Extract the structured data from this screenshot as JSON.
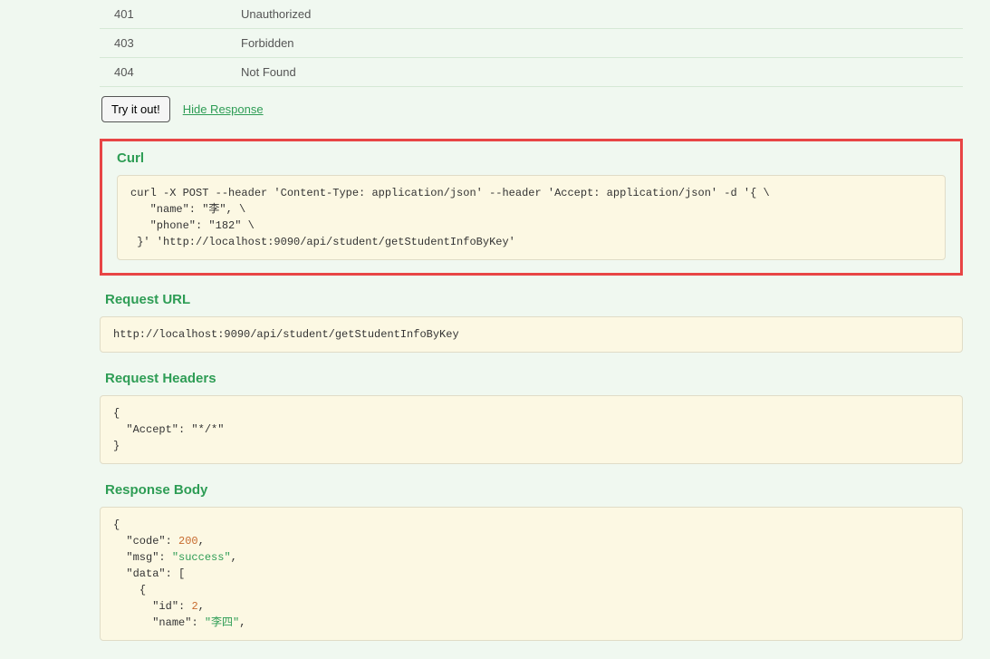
{
  "status_codes": [
    {
      "code": "401",
      "text": "Unauthorized"
    },
    {
      "code": "403",
      "text": "Forbidden"
    },
    {
      "code": "404",
      "text": "Not Found"
    }
  ],
  "actions": {
    "try_label": "Try it out!",
    "hide_label": "Hide Response"
  },
  "sections": {
    "curl": {
      "title": "Curl",
      "content": "curl -X POST --header 'Content-Type: application/json' --header 'Accept: application/json' -d '{ \\ \n   \"name\": \"李\", \\ \n   \"phone\": \"182\" \\ \n }' 'http://localhost:9090/api/student/getStudentInfoByKey'"
    },
    "request_url": {
      "title": "Request URL",
      "content": "http://localhost:9090/api/student/getStudentInfoByKey"
    },
    "request_headers": {
      "title": "Request Headers",
      "content": "{\n  \"Accept\": \"*/*\"\n}"
    },
    "response_body": {
      "title": "Response Body",
      "tokens": [
        {
          "t": "punc",
          "v": "{"
        },
        {
          "t": "nl",
          "indent": 1
        },
        {
          "t": "key",
          "v": "\"code\""
        },
        {
          "t": "punc",
          "v": ": "
        },
        {
          "t": "num",
          "v": "200"
        },
        {
          "t": "punc",
          "v": ","
        },
        {
          "t": "nl",
          "indent": 1
        },
        {
          "t": "key",
          "v": "\"msg\""
        },
        {
          "t": "punc",
          "v": ": "
        },
        {
          "t": "str",
          "v": "\"success\""
        },
        {
          "t": "punc",
          "v": ","
        },
        {
          "t": "nl",
          "indent": 1
        },
        {
          "t": "key",
          "v": "\"data\""
        },
        {
          "t": "punc",
          "v": ": ["
        },
        {
          "t": "nl",
          "indent": 2
        },
        {
          "t": "punc",
          "v": "{"
        },
        {
          "t": "nl",
          "indent": 3
        },
        {
          "t": "key",
          "v": "\"id\""
        },
        {
          "t": "punc",
          "v": ": "
        },
        {
          "t": "num",
          "v": "2"
        },
        {
          "t": "punc",
          "v": ","
        },
        {
          "t": "nl",
          "indent": 3
        },
        {
          "t": "key",
          "v": "\"name\""
        },
        {
          "t": "punc",
          "v": ": "
        },
        {
          "t": "str",
          "v": "\"李四\""
        },
        {
          "t": "punc",
          "v": ","
        }
      ]
    }
  }
}
